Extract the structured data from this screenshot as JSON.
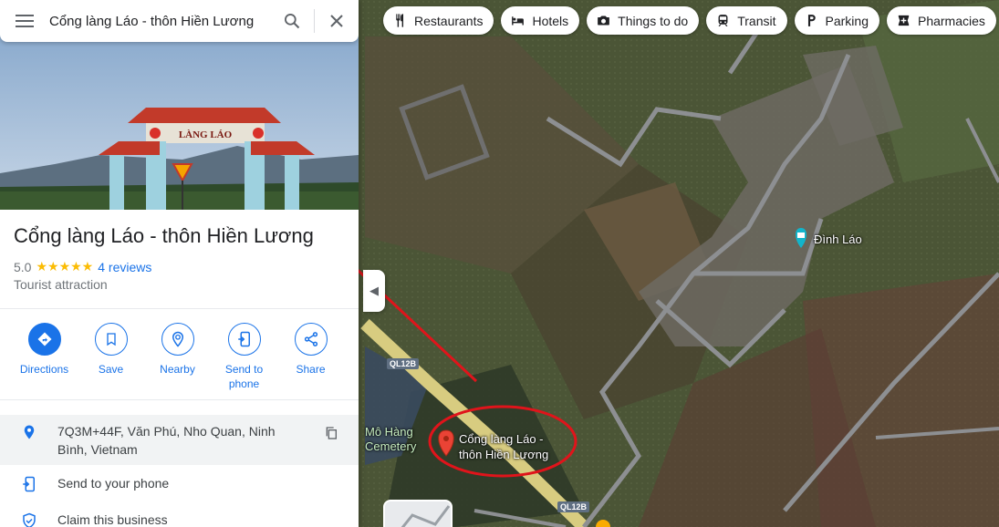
{
  "search": {
    "query": "Cổng làng Láo -  thôn Hiền Lương"
  },
  "place": {
    "title": "Cổng làng Láo - thôn Hiền Lương",
    "rating": "5.0",
    "stars": "★★★★★",
    "reviews": "4 reviews",
    "category": "Tourist attraction",
    "photo_sign": "LÀNG LÁO"
  },
  "actions": [
    {
      "label": "Directions",
      "icon": "directions-icon"
    },
    {
      "label": "Save",
      "icon": "bookmark-icon"
    },
    {
      "label": "Nearby",
      "icon": "nearby-icon"
    },
    {
      "label": "Send to phone",
      "icon": "send-to-phone-icon"
    },
    {
      "label": "Share",
      "icon": "share-icon"
    }
  ],
  "info": {
    "address": "7Q3M+44F, Văn Phú, Nho Quan, Ninh Bình, Vietnam",
    "send_to_phone": "Send to your phone",
    "claim": "Claim this business"
  },
  "chips": [
    {
      "label": "Restaurants",
      "icon": "restaurant-icon"
    },
    {
      "label": "Hotels",
      "icon": "hotel-icon"
    },
    {
      "label": "Things to do",
      "icon": "camera-icon"
    },
    {
      "label": "Transit",
      "icon": "transit-icon"
    },
    {
      "label": "Parking",
      "icon": "parking-icon"
    },
    {
      "label": "Pharmacies",
      "icon": "pharmacy-icon"
    }
  ],
  "map": {
    "poi_dinh_lao": "Đình Láo",
    "pin_label_line1": "Cổng làng Láo -",
    "pin_label_line2": "thôn Hiền Lương",
    "cemetery_line1": "Mô Hàng",
    "cemetery_line2": "Cemetery",
    "road_label_1": "QL12B",
    "road_label_2": "QL12B"
  },
  "colors": {
    "accent": "#1a73e8",
    "star": "#fbbc04",
    "annotation": "#e0141b",
    "pin": "#ea4335"
  }
}
